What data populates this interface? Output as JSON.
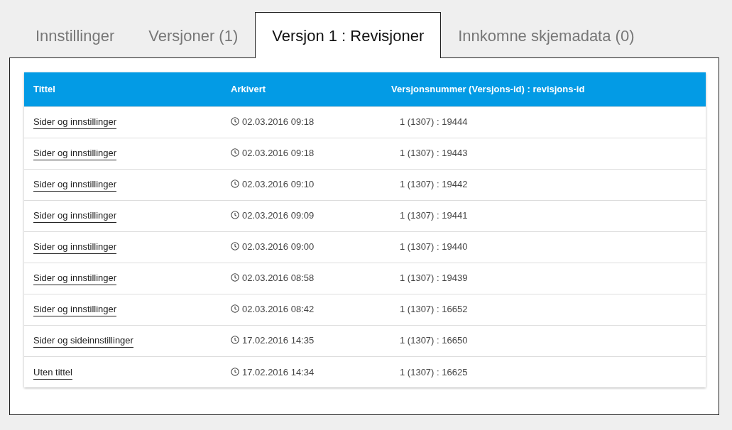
{
  "tabs": [
    {
      "label": "Innstillinger",
      "selected": false
    },
    {
      "label": "Versjoner (1)",
      "selected": false
    },
    {
      "label": "Versjon 1 : Revisjoner",
      "selected": true
    },
    {
      "label": "Innkomne skjemadata (0)",
      "selected": false
    }
  ],
  "table": {
    "columns": [
      "Tittel",
      "Arkivert",
      "Versjonsnummer (Versjons-id) : revisjons-id"
    ],
    "rows": [
      {
        "title": "Sider og innstillinger",
        "archived": "02.03.2016 09:18",
        "version": "1 (1307) : 19444"
      },
      {
        "title": "Sider og innstillinger",
        "archived": "02.03.2016 09:18",
        "version": "1 (1307) : 19443"
      },
      {
        "title": "Sider og innstillinger",
        "archived": "02.03.2016 09:10",
        "version": "1 (1307) : 19442"
      },
      {
        "title": "Sider og innstillinger",
        "archived": "02.03.2016 09:09",
        "version": "1 (1307) : 19441"
      },
      {
        "title": "Sider og innstillinger",
        "archived": "02.03.2016 09:00",
        "version": "1 (1307) : 19440"
      },
      {
        "title": "Sider og innstillinger",
        "archived": "02.03.2016 08:58",
        "version": "1 (1307) : 19439"
      },
      {
        "title": "Sider og innstillinger",
        "archived": "02.03.2016 08:42",
        "version": "1 (1307) : 16652"
      },
      {
        "title": "Sider og sideinnstillinger",
        "archived": "17.02.2016 14:35",
        "version": "1 (1307) : 16650"
      },
      {
        "title": "Uten tittel",
        "archived": "17.02.2016 14:34",
        "version": "1 (1307) : 16625"
      }
    ]
  }
}
